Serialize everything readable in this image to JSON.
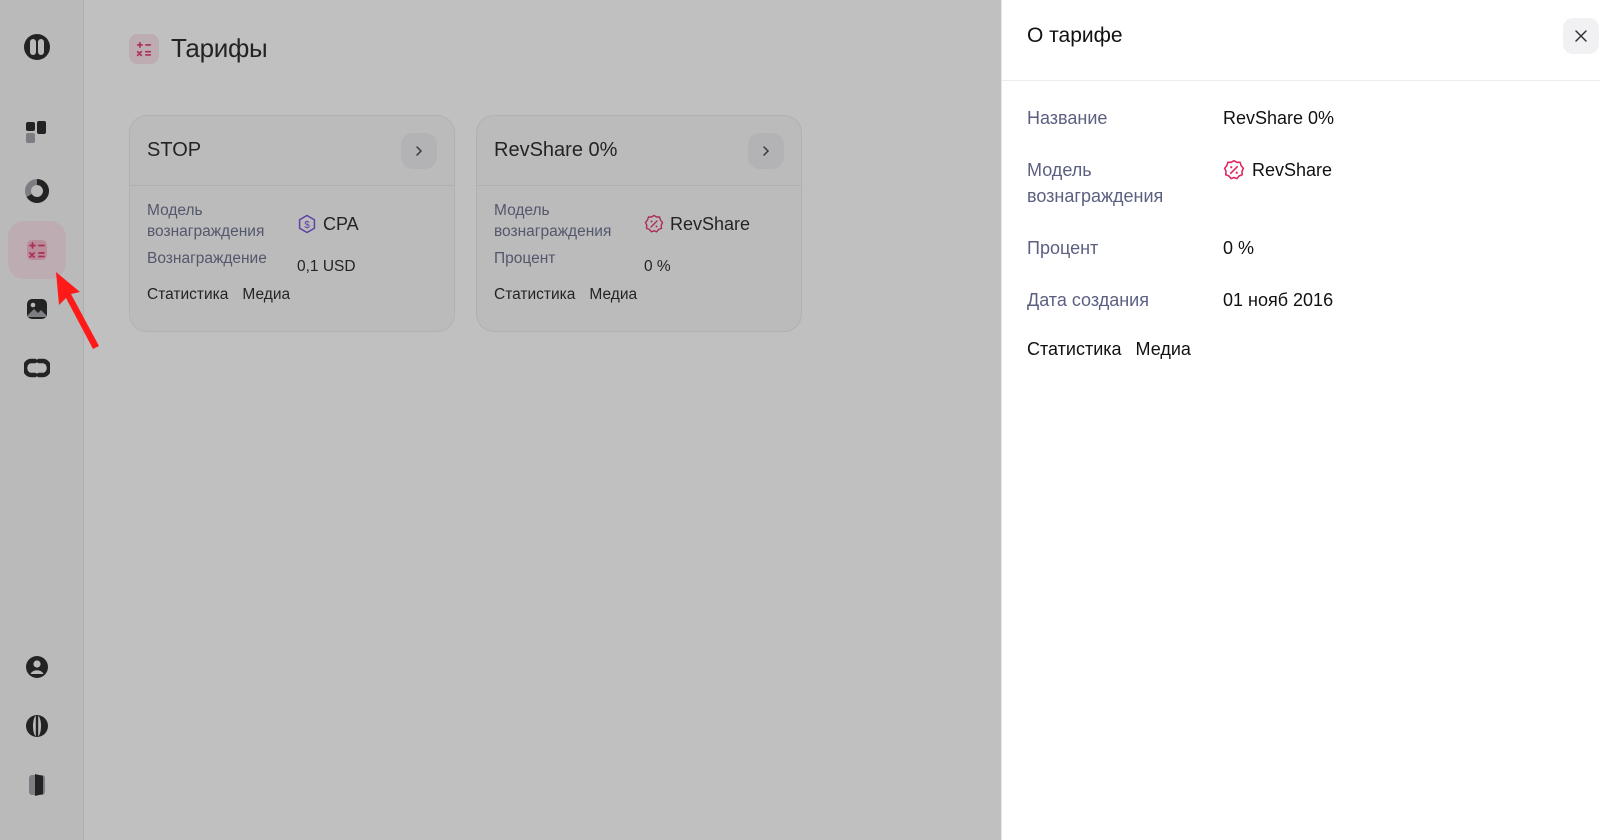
{
  "page": {
    "title": "Тарифы"
  },
  "sidebar": {
    "items": [
      {
        "icon": "logo-icon"
      },
      {
        "icon": "dashboard-icon"
      },
      {
        "icon": "statistics-icon"
      },
      {
        "icon": "tariffs-icon",
        "active": true
      },
      {
        "icon": "media-icon"
      },
      {
        "icon": "links-icon"
      },
      {
        "icon": "profile-icon"
      },
      {
        "icon": "language-icon"
      },
      {
        "icon": "logout-icon"
      }
    ]
  },
  "cards": [
    {
      "title": "STOP",
      "rows": [
        {
          "label": "Модель вознаграждения",
          "value": "CPA",
          "icon": "cpa-icon"
        },
        {
          "label": "Вознаграждение",
          "value": "0,1 USD"
        }
      ],
      "links": [
        "Статистика",
        "Медиа"
      ]
    },
    {
      "title": "RevShare 0%",
      "rows": [
        {
          "label": "Модель вознаграждения",
          "value": "RevShare",
          "icon": "revshare-icon"
        },
        {
          "label": "Процент",
          "value": "0 %"
        }
      ],
      "links": [
        "Статистика",
        "Медиа"
      ]
    }
  ],
  "drawer": {
    "title": "О тарифе",
    "rows": [
      {
        "label": "Название",
        "value": "RevShare 0%"
      },
      {
        "label": "Модель вознаграждения",
        "value": "RevShare",
        "icon": "revshare-icon"
      },
      {
        "label": "Процент",
        "value": "0 %"
      },
      {
        "label": "Дата создания",
        "value": "01 нояб 2016"
      }
    ],
    "links": [
      "Статистика",
      "Медиа"
    ]
  },
  "colors": {
    "accent": "#e0245e",
    "cpa": "#6b3fd4",
    "muted_label": "#5c6080",
    "overlay": "rgba(70,70,70,0.34)",
    "pointer": "#ff1a1a"
  }
}
